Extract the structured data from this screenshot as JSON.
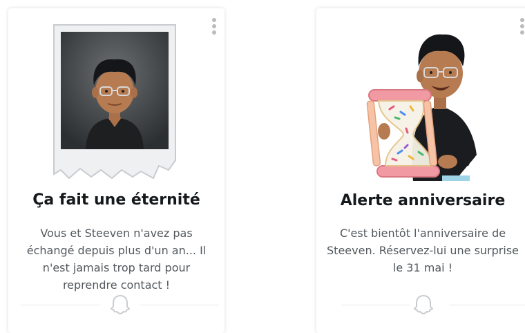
{
  "cards": [
    {
      "title": "Ça fait une éternité",
      "text": "Vous et Steeven n'avez pas échangé depuis plus d'un an... Il n'est jamais trop tard pour reprendre contact !",
      "illustration": "bitmoji-polaroid-photo",
      "menu_icon": "more-vertical-icon",
      "footer_icon": "ghost-icon"
    },
    {
      "title": "Alerte anniversaire",
      "text": "C'est bientôt l'anniversaire de Steeven. Réservez-lui une surprise le 31 mai !",
      "illustration": "bitmoji-hourglass",
      "menu_icon": "more-vertical-icon",
      "footer_icon": "ghost-icon"
    }
  ],
  "colors": {
    "title": "#16191c",
    "body_text": "#52585d",
    "icon_grey": "#b9bcbf",
    "divider": "#e6e8ea"
  }
}
